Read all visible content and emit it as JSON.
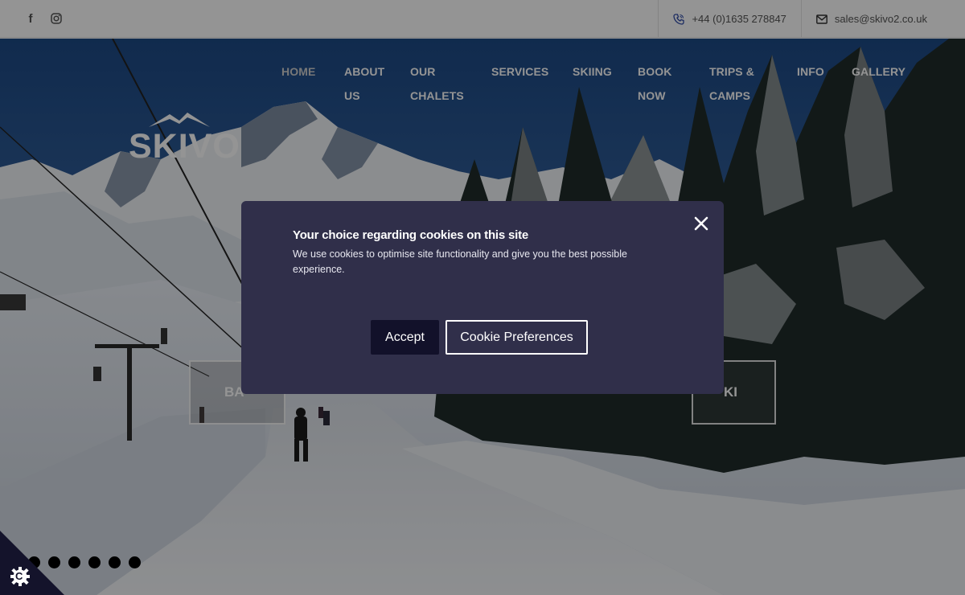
{
  "topbar": {
    "social": [
      {
        "icon": "facebook-icon",
        "glyph": "f"
      },
      {
        "icon": "instagram-icon"
      }
    ],
    "phone": "+44 (0)1635 278847",
    "email": "sales@skivo2.co.uk"
  },
  "header": {
    "logo_text": "SKIVO",
    "nav": [
      {
        "lines": [
          "HOME"
        ],
        "active": true
      },
      {
        "lines": [
          "ABOUT",
          "US"
        ]
      },
      {
        "lines": [
          "OUR",
          "CHALETS"
        ]
      },
      {
        "lines": [
          "SERVICES"
        ]
      },
      {
        "lines": [
          "SKIING"
        ]
      },
      {
        "lines": [
          "BOOK",
          "NOW"
        ]
      },
      {
        "lines": [
          "TRIPS &",
          "CAMPS"
        ]
      },
      {
        "lines": [
          "INFO"
        ]
      },
      {
        "lines": [
          "GALLERY"
        ]
      }
    ]
  },
  "hero": {
    "slide_left_label": "BA",
    "slide_right_label": "KI",
    "slider_dot_count": 7,
    "slider_active_index": 0
  },
  "cookie_modal": {
    "title": "Your choice regarding cookies on this site",
    "text": "We use cookies to optimise site functionality and give you the best possible experience.",
    "accept_label": "Accept",
    "prefs_label": "Cookie Preferences",
    "bg_color": "#302f4a"
  },
  "cookie_tab": {
    "icon": "cookie-gear-icon",
    "glyph": "C"
  }
}
